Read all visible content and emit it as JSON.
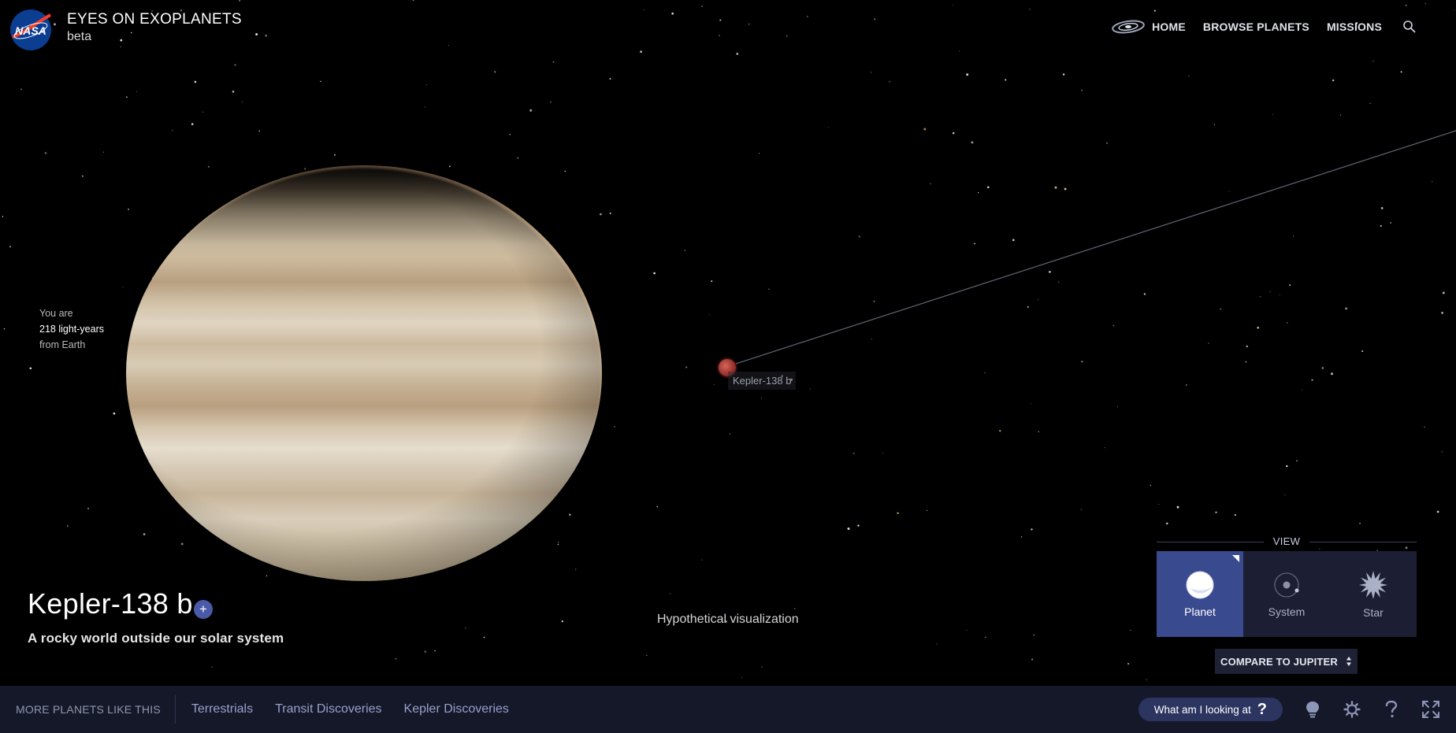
{
  "header": {
    "logo_text": "NASA",
    "title": "EYES ON EXOPLANETS",
    "subtitle": "beta",
    "nav": [
      {
        "label": "HOME",
        "icon": "galaxy-icon"
      },
      {
        "label": "BROWSE PLANETS"
      },
      {
        "label": "MISSIONS"
      }
    ],
    "search_icon": "search-icon"
  },
  "distance": {
    "line1": "You are",
    "value": "218 light-years",
    "line3": "from Earth"
  },
  "marker": {
    "label": "Kepler-138 b"
  },
  "planet_info": {
    "name": "Kepler-138 b",
    "add_label": "+",
    "description": "A rocky world outside our solar system"
  },
  "caption": "Hypothetical visualization",
  "view": {
    "heading": "VIEW",
    "options": [
      {
        "label": "Planet",
        "icon": "planet-icon",
        "active": true
      },
      {
        "label": "System",
        "icon": "system-icon",
        "active": false
      },
      {
        "label": "Star",
        "icon": "star-icon",
        "active": false
      }
    ],
    "compare_label": "COMPARE TO JUPITER"
  },
  "bottom_bar": {
    "more_label": "MORE PLANETS LIKE THIS",
    "categories": [
      "Terrestrials",
      "Transit Discoveries",
      "Kepler Discoveries"
    ],
    "what_label": "What am I looking at",
    "what_q": "?",
    "icons": [
      "lightbulb-icon",
      "settings-icon",
      "help-icon",
      "fullscreen-icon"
    ]
  },
  "colors": {
    "accent": "#3a4a8e",
    "bar_bg": "#141829",
    "link": "#98a1c9",
    "nasa_blue": "#0b3d91",
    "nasa_red": "#fc3d21"
  }
}
